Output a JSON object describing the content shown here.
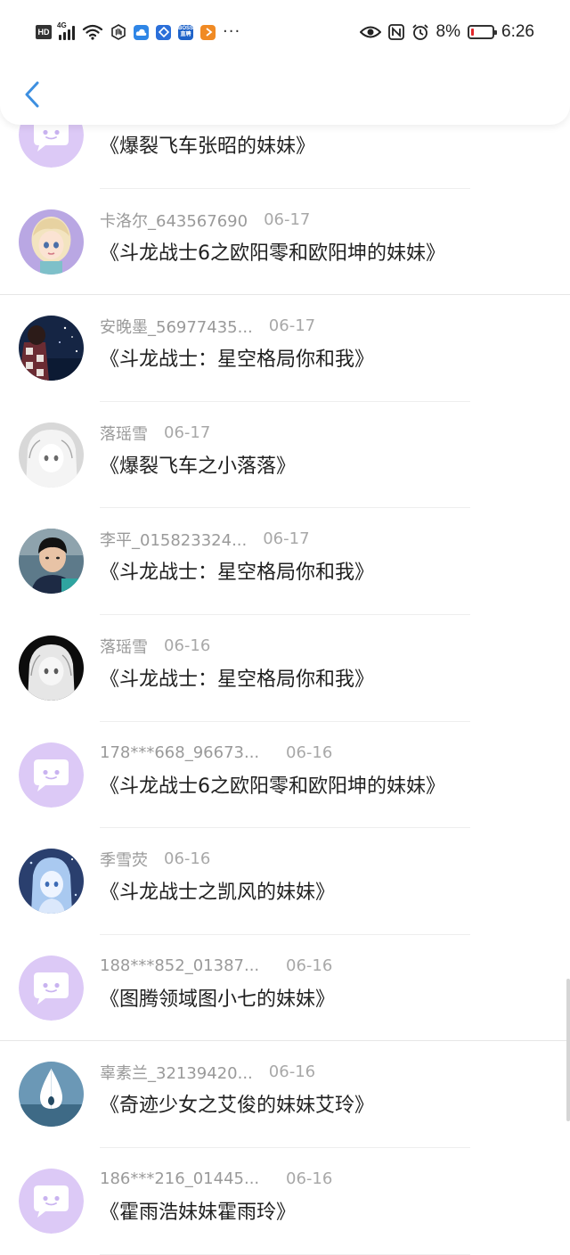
{
  "status_bar": {
    "hd": "HD",
    "network": "4G",
    "wifi_tag": "6",
    "apps": [
      "B",
      "B",
      "S",
      ">"
    ],
    "boss_label": "BOSS 直聘",
    "more": "···",
    "battery_percent": "8%",
    "time": "6:26"
  },
  "nav": {
    "back_icon": "chevron-left-icon"
  },
  "colors": {
    "accent_blue": "#3d8fe0",
    "chat_purple": "#d7c6f5",
    "battery_red": "#e2262a"
  },
  "list": [
    {
      "name": "",
      "date": "",
      "title": "《爆裂飞车张昭的妹妹》",
      "avatar": "chat"
    },
    {
      "name": "卡洛尔_643567690",
      "date": "06-17",
      "title": "《斗龙战士6之欧阳零和欧阳坤的妹妹》",
      "avatar": "doll"
    },
    {
      "name": "安晚墨_56977435...",
      "date": "06-17",
      "title": "《斗龙战士：星空格局你和我》",
      "avatar": "night"
    },
    {
      "name": "落瑶雪",
      "date": "06-17",
      "title": "《爆裂飞车之小落落》",
      "avatar": "anime-light"
    },
    {
      "name": "李平_015823324...",
      "date": "06-17",
      "title": "《斗龙战士：星空格局你和我》",
      "avatar": "photo"
    },
    {
      "name": "落瑶雪",
      "date": "06-16",
      "title": "《斗龙战士：星空格局你和我》",
      "avatar": "anime-dark"
    },
    {
      "name": "178***668_96673...",
      "date": "06-16",
      "title": "《斗龙战士6之欧阳零和欧阳坤的妹妹》",
      "avatar": "chat"
    },
    {
      "name": "季雪荧",
      "date": "06-16",
      "title": "《斗龙战士之凯风的妹妹》",
      "avatar": "anime-blue"
    },
    {
      "name": "188***852_01387...",
      "date": "06-16",
      "title": "《图腾领域图小七的妹妹》",
      "avatar": "chat"
    },
    {
      "name": "辜素兰_32139420...",
      "date": "06-16",
      "title": "《奇迹少女之艾俊的妹妹艾玲》",
      "avatar": "drop"
    },
    {
      "name": "186***216_01445...",
      "date": "06-16",
      "title": "《霍雨浩妹妹霍雨玲》",
      "avatar": "chat"
    }
  ]
}
